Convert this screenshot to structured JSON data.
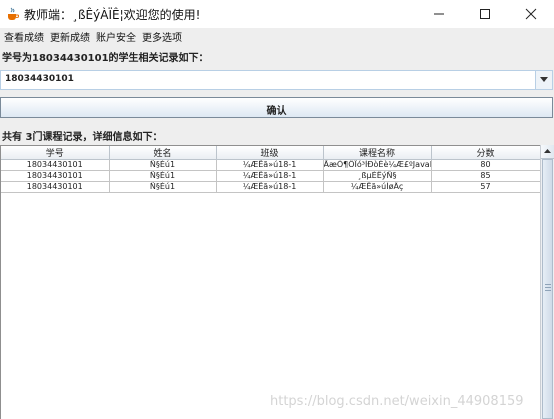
{
  "window": {
    "title": "教师端：¸ßÊýÀÏÊ¦欢迎您的使用!"
  },
  "menu": {
    "items": [
      {
        "label": "查看成绩"
      },
      {
        "label": "更新成绩"
      },
      {
        "label": "账户安全"
      },
      {
        "label": "更多选项"
      }
    ]
  },
  "student": {
    "heading": "学号为18034430101的学生相关记录如下：",
    "selected_id": "18034430101"
  },
  "confirm": {
    "label": "确认"
  },
  "records": {
    "summary": "共有 3门课程记录，详细信息如下：",
    "columns": [
      "学号",
      "姓名",
      "班级",
      "课程名称",
      "分数"
    ],
    "rows": [
      [
        "18034430101",
        "Ñ§Éú1",
        "¼ÆËã»ú18-1",
        "Ãæ­Ò¶ÔÏó³ÌÐòÉè¼Æ£ºJavaÊµ¼ù",
        "80"
      ],
      [
        "18034430101",
        "Ñ§Éú1",
        "¼ÆËã»ú18-1",
        "¸ßµÈÊýÑ§",
        "85"
      ],
      [
        "18034430101",
        "Ñ§Éú1",
        "¼ÆËã»ú18-1",
        "¼ÆËã»úÍøÂç",
        "57"
      ]
    ]
  },
  "watermark": "https://blog.csdn.net/weixin_44908159",
  "colors": {
    "background": "#eeeeee",
    "table_background": "#ffffff",
    "header_gradient_bottom": "#eaeef3",
    "border": "#b8cfe5"
  },
  "icons": {
    "app": "java-coffee-cup-icon",
    "minimize": "minimize-icon",
    "maximize": "maximize-icon",
    "close": "close-icon",
    "dropdown": "chevron-down-icon",
    "scroll_up": "arrow-up-icon"
  }
}
